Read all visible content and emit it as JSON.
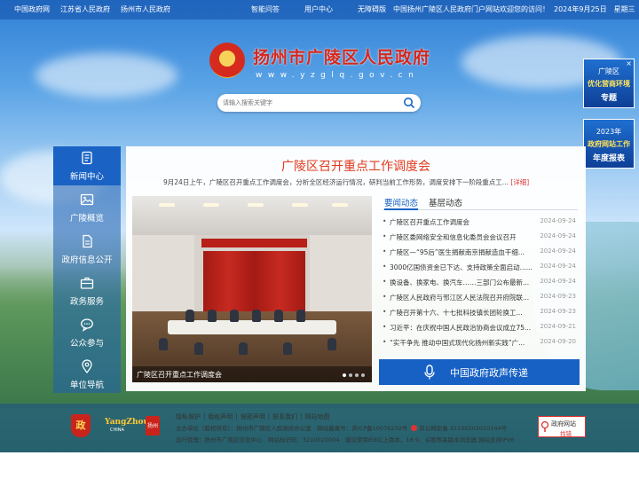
{
  "topbar": {
    "links_left": [
      "中国政府网",
      "江苏省人民政府",
      "扬州市人民政府"
    ],
    "links_mid": [
      "智能问答",
      "用户中心",
      "无障碍版"
    ],
    "welcome": "中国扬州广陵区人民政府门户网站欢迎您的访问！",
    "date": "2024年9月25日　星期三"
  },
  "header": {
    "title": "扬州市广陵区人民政府",
    "url": "www.yzglq.gov.cn"
  },
  "search": {
    "placeholder": "请输入搜索关键字"
  },
  "ads": [
    {
      "l1": "广陵区",
      "l2": "优化营商环境",
      "l3": "专题"
    },
    {
      "l1": "2023年",
      "l2": "政府网站工作",
      "l3": "年度报表"
    }
  ],
  "leftnav": [
    {
      "label": "新闻中心",
      "icon": "newspaper-icon"
    },
    {
      "label": "广陵概览",
      "icon": "picture-icon"
    },
    {
      "label": "政府信息公开",
      "icon": "document-icon"
    },
    {
      "label": "政务服务",
      "icon": "briefcase-icon"
    },
    {
      "label": "公众参与",
      "icon": "chat-icon"
    },
    {
      "label": "单位导航",
      "icon": "location-icon"
    }
  ],
  "main": {
    "headline": "广陵区召开重点工作调度会",
    "summary": "9月24日上午，广陵区召开重点工作调度会，分析全区经济运行情况，研判当前工作形势，调度安排下一阶段重点工...",
    "more": "[详细]",
    "photo": {
      "banner": "全区重点工作调度会",
      "caption": "广陵区召开重点工作调度会"
    },
    "tabs": [
      "要闻动态",
      "基层动态"
    ],
    "news": [
      {
        "title": "广陵区召开重点工作调度会",
        "date": "2024-09-24"
      },
      {
        "title": "广陵区委网络安全和信息化委员会会议召开",
        "date": "2024-09-24"
      },
      {
        "title": "广陵区—“95后”医生捐献南京捐献造血干细...",
        "date": "2024-09-24"
      },
      {
        "title": "3000亿国债资金已下达、支持政策全面启动......",
        "date": "2024-09-24"
      },
      {
        "title": "换设备、换家电、换汽车……三部门公布最新...",
        "date": "2024-09-24"
      },
      {
        "title": "广陵区人民政府与邗江区人民法院召开府院联...",
        "date": "2024-09-23"
      },
      {
        "title": "广陵召开第十六、十七批科技镇长团轮换工...",
        "date": "2024-09-23"
      },
      {
        "title": "习近平：在庆祝中国人民政治协商会议成立75...",
        "date": "2024-09-21"
      },
      {
        "title": "“实干争先 推动中国式现代化扬州新实践”广...",
        "date": "2024-09-20"
      }
    ],
    "voice": "中国政府政声传递"
  },
  "footer": {
    "links": [
      "隐私保护",
      "|",
      "版权声明",
      "|",
      "保密声明",
      "|",
      "联系我们",
      "|",
      "网站地图"
    ],
    "info1": "主办单位（版权所有）：扬州市广陵区人民政府办公室　网站备案号：苏ICP备10076232号",
    "info1b": "苏公网安备 32100202010144号",
    "info2": "运行管理：扬州市广陵区信息中心　网站标识码：3210020004　建议使用IE8以上版本、16:9、谷歌等高版本浏览器 网站支持IPV6",
    "logo_text": "政",
    "yangzhou": "YangZhou",
    "yangzhou_sub": "CHINA",
    "mark": "扬州",
    "err_l1": "政府网站",
    "err_l2": "找错"
  }
}
